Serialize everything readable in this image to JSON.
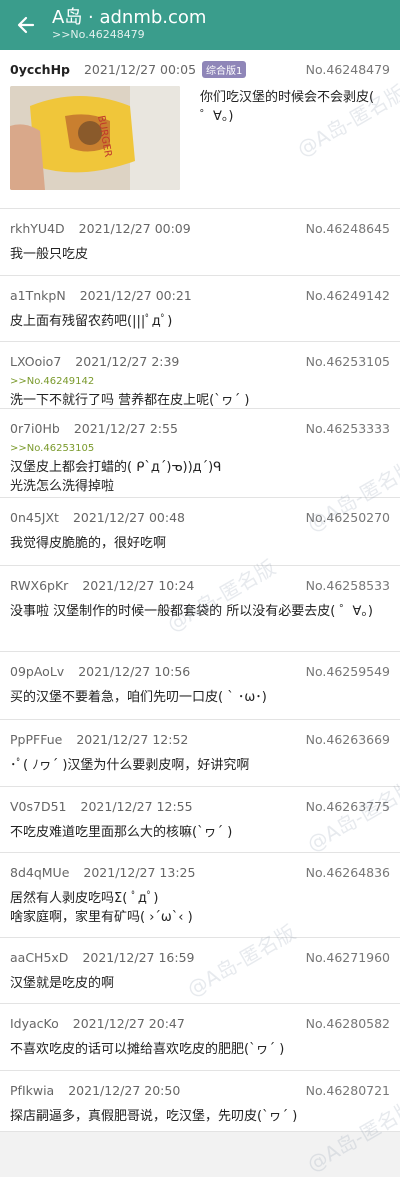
{
  "header": {
    "title": "A岛 · adnmb.com",
    "subtitle": ">>No.46248479"
  },
  "op": {
    "uid": "0ycchHp",
    "time": "2021/12/27 00:05",
    "tag": "综合版1",
    "pid": "No.46248479",
    "text": "你们吃汉堡的时候会不会剥皮( ゜∀。)"
  },
  "replies": [
    {
      "uid": "rkhYU4D",
      "time": "2021/12/27 00:09",
      "pid": "No.46248645",
      "quote": "",
      "text": "我一般只吃皮"
    },
    {
      "uid": "a1TnkpN",
      "time": "2021/12/27 00:21",
      "pid": "No.46249142",
      "quote": "",
      "text": "皮上面有残留农药吧(|||ﾟдﾟ)"
    },
    {
      "uid": "LXOoio7",
      "time": "2021/12/27 2:39",
      "pid": "No.46253105",
      "quote": ">>No.46249142",
      "text": "洗一下不就行了吗 营养都在皮上呢(`ヮ´ )"
    },
    {
      "uid": "0r7i0Hb",
      "time": "2021/12/27 2:55",
      "pid": "No.46253333",
      "quote": ">>No.46253105",
      "text": "汉堡皮上都会打蜡的( ᑭ`д´)ᓀ))д´)ᑫ\n光洗怎么洗得掉啦"
    },
    {
      "uid": "0n45JXt",
      "time": "2021/12/27 00:48",
      "pid": "No.46250270",
      "quote": "",
      "text": "我觉得皮脆脆的，很好吃啊"
    },
    {
      "uid": "RWX6pKr",
      "time": "2021/12/27 10:24",
      "pid": "No.46258533",
      "quote": "",
      "text": "没事啦 汉堡制作的时候一般都套袋的 所以没有必要去皮( ゜∀。)"
    },
    {
      "uid": "09pAoLv",
      "time": "2021/12/27 10:56",
      "pid": "No.46259549",
      "quote": "",
      "text": "买的汉堡不要着急，咱们先叨一口皮( ` ･ω･)"
    },
    {
      "uid": "PpPFFue",
      "time": "2021/12/27 12:52",
      "pid": "No.46263669",
      "quote": "",
      "text": "･ﾟ( ﾉヮ´ )汉堡为什么要剥皮啊，好讲究啊"
    },
    {
      "uid": "V0s7D51",
      "time": "2021/12/27 12:55",
      "pid": "No.46263775",
      "quote": "",
      "text": "不吃皮难道吃里面那么大的核嘛(`ヮ´ )"
    },
    {
      "uid": "8d4qMUe",
      "time": "2021/12/27 13:25",
      "pid": "No.46264836",
      "quote": "",
      "text": "居然有人剥皮吃吗Σ( ﾟдﾟ)\n啥家庭啊，家里有矿吗( ›´ω`‹ )"
    },
    {
      "uid": "aaCH5xD",
      "time": "2021/12/27 16:59",
      "pid": "No.46271960",
      "quote": "",
      "text": "汉堡就是吃皮的啊"
    },
    {
      "uid": "IdyacKo",
      "time": "2021/12/27 20:47",
      "pid": "No.46280582",
      "quote": "",
      "text": "不喜欢吃皮的话可以摊给喜欢吃皮的肥肥(`ヮ´ )"
    },
    {
      "uid": "PfIkwia",
      "time": "2021/12/27 20:50",
      "pid": "No.46280721",
      "quote": "",
      "text": "探店嗣逼多，真假肥哥说，吃汉堡，先叨皮(`ヮ´ )"
    }
  ],
  "watermark": "@A岛-匿名版",
  "colors": {
    "header": "#3a9d8c",
    "quote": "#7a9a2c",
    "tag": "#8f86b8"
  }
}
